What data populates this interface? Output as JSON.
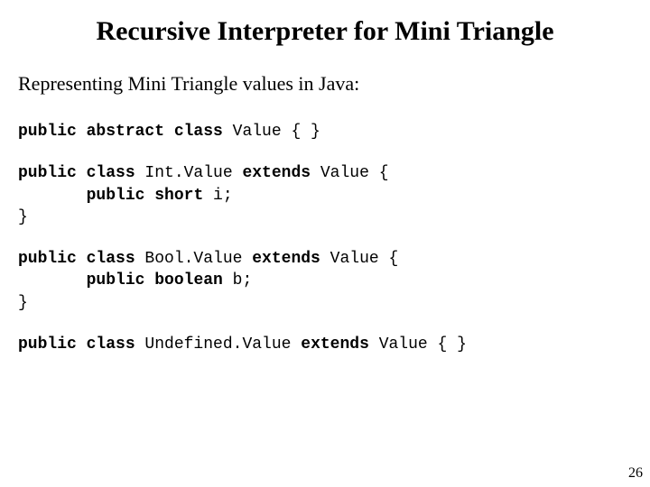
{
  "title": "Recursive Interpreter for Mini Triangle",
  "subtitle": "Representing Mini Triangle values in Java:",
  "code": {
    "b1": {
      "kw1": "public abstract class",
      "txt1": " Value { }"
    },
    "b2": {
      "kw1": "public class",
      "txt1": " Int.Value ",
      "kw2": "extends",
      "txt2": " Value {",
      "kw3": "public short",
      "txt3": " i;",
      "txt4": "}"
    },
    "b3": {
      "kw1": "public class",
      "txt1": " Bool.Value ",
      "kw2": "extends",
      "txt2": " Value {",
      "kw3": "public boolean",
      "txt3": " b;",
      "txt4": "}"
    },
    "b4": {
      "kw1": "public class",
      "txt1": " Undefined.Value ",
      "kw2": "extends",
      "txt2": " Value { }"
    }
  },
  "pagenum": "26"
}
